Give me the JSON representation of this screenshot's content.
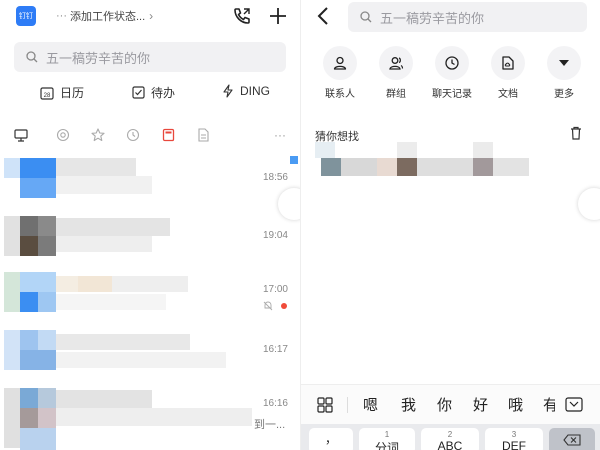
{
  "left": {
    "app_logo_text": "钉钉",
    "status_chip": {
      "dots": "···",
      "label": "添加工作状态...",
      "chevron": "›"
    },
    "search": {
      "placeholder": "五一稿劳辛苦的你"
    },
    "quick_actions": [
      {
        "label": "日历",
        "badge": "28",
        "icon": "calendar-icon"
      },
      {
        "label": "待办",
        "icon": "todo-check-icon"
      },
      {
        "label": "DING",
        "icon": "ding-lightning-icon"
      }
    ],
    "filter_tabs": [
      "monitor-icon",
      "at-icon",
      "star-icon",
      "clock-icon",
      "calendar-red-icon",
      "document-icon",
      "more-dots-icon"
    ],
    "filter_more": "···",
    "chats": [
      {
        "time": "18:56"
      },
      {
        "time": "19:04"
      },
      {
        "time": "17:00",
        "muted": true,
        "unread": true
      },
      {
        "time": "16:17"
      },
      {
        "time": "16:16",
        "snippet": "到一..."
      }
    ]
  },
  "right": {
    "search": {
      "placeholder": "五一稿劳辛苦的你"
    },
    "categories": [
      {
        "label": "联系人",
        "icon": "contact-person-icon"
      },
      {
        "label": "群组",
        "icon": "group-icon"
      },
      {
        "label": "聊天记录",
        "icon": "chat-history-clock-icon"
      },
      {
        "label": "文档",
        "icon": "document-cloud-icon"
      },
      {
        "label": "更多",
        "icon": "caret-down-icon"
      }
    ],
    "guess_title": "猜你想找",
    "candidates": [
      "嗯",
      "我",
      "你",
      "好",
      "哦",
      "有"
    ],
    "keys": [
      {
        "num": "",
        "main": "，"
      },
      {
        "num": "1",
        "main": "分词"
      },
      {
        "num": "2",
        "main": "ABC"
      },
      {
        "num": "3",
        "main": "DEF"
      }
    ]
  },
  "colors": {
    "accent": "#2e7cf6",
    "unread": "#f04b3a",
    "search_bg": "#f1f1f3",
    "filter_active": "#e8473c"
  }
}
